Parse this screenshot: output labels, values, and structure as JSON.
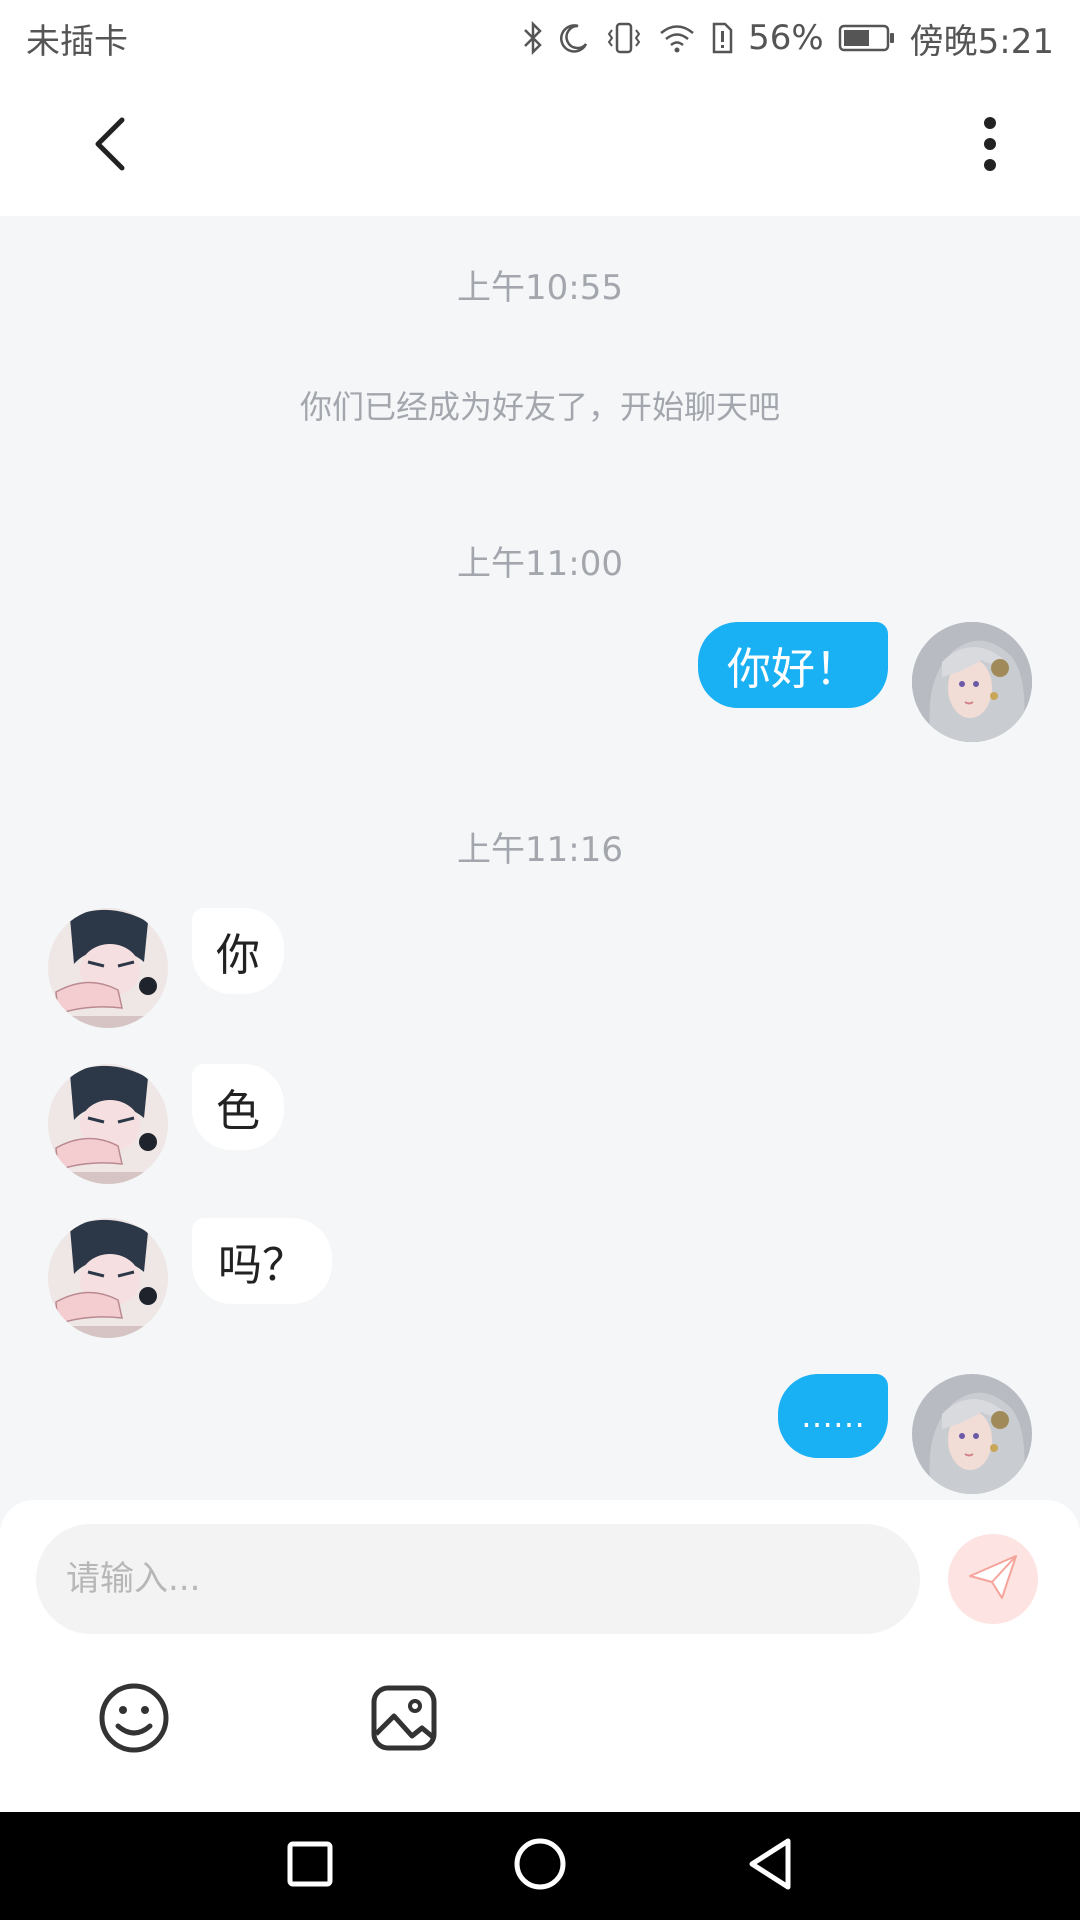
{
  "status_bar": {
    "carrier": "未插卡",
    "battery": "56%",
    "time": "傍晚5:21",
    "icons": [
      "bluetooth-icon",
      "moon-icon",
      "vibrate-icon",
      "wifi-icon",
      "alert-icon",
      "battery-icon"
    ]
  },
  "nav": {
    "back_icon": "chevron-left-icon",
    "menu_icon": "more-vertical-icon"
  },
  "chat": {
    "time_1": "上午10:55",
    "system_message": "你们已经成为好友了，开始聊天吧",
    "time_2": "上午11:00",
    "msg_out_1": "你好！",
    "time_3": "上午11:16",
    "msg_in_1": "你",
    "msg_in_2": "色",
    "msg_in_3": "吗？",
    "msg_out_2": "……"
  },
  "composer": {
    "placeholder": "请输入...",
    "send_icon": "paper-plane-icon",
    "emoji_icon": "smiley-icon",
    "image_icon": "image-icon"
  },
  "colors": {
    "outgoing_bubble": "#1ab0f4",
    "incoming_bubble": "#ffffff",
    "background": "#f4f6f8",
    "send_button": "#fde3e1",
    "send_icon": "#f6a49b"
  }
}
